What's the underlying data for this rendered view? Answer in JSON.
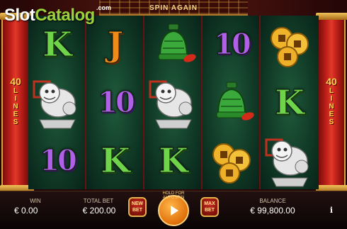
{
  "header": {
    "banner": "SPIN AGAIN"
  },
  "logo": {
    "part1": "Slot",
    "part2": "Catalog",
    "suffix": ".com"
  },
  "pillars": {
    "left_num": "40",
    "left_word": "LINES",
    "right_num": "40",
    "right_word": "LINES"
  },
  "reels": [
    [
      "K",
      "foo-dog",
      "10"
    ],
    [
      "J",
      "10",
      "K"
    ],
    [
      "bell",
      "foo-dog",
      "K"
    ],
    [
      "10",
      "bell",
      "coins"
    ],
    [
      "coins",
      "K",
      "foo-dog"
    ]
  ],
  "bottom": {
    "win_label": "WIN",
    "win_value": "€ 0.00",
    "totalbet_label": "TOTAL BET",
    "totalbet_value": "€ 200.00",
    "newbet_line1": "NEW",
    "newbet_line2": "BET",
    "spin_hint": "HOLD FOR AUTOSPIN",
    "maxbet_line1": "MAX",
    "maxbet_line2": "BET",
    "balance_label": "BALANCE",
    "balance_value": "€ 99,800.00",
    "info": "i"
  },
  "colors": {
    "pillar": "#c8241c",
    "gold": "#e6b24a",
    "reel_bg": "#0e3322",
    "spin": "#e0700a"
  },
  "icons": [
    "foo-dog-statue-icon",
    "green-bell-icon",
    "gold-coins-icon",
    "play-icon",
    "info-icon"
  ]
}
